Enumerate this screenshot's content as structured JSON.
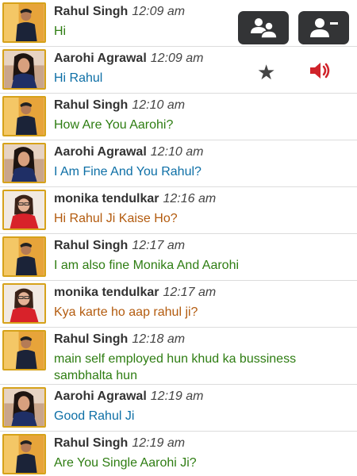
{
  "toolbar": {
    "group_icon": "group-users-icon",
    "remove_icon": "remove-user-icon",
    "star_icon": "star-icon",
    "volume_icon": "volume-icon",
    "volume_color": "#d0232a"
  },
  "colors": {
    "rahul_text": "#2e7d12",
    "aarohi_text": "#0d6fa6",
    "monika_text": "#b35b0e",
    "avatar_border": "#d6a21a"
  },
  "messages": [
    {
      "sender": "Rahul Singh",
      "time": "12:09 am",
      "text": "Hi",
      "kind": "rahul"
    },
    {
      "sender": "Aarohi Agrawal",
      "time": "12:09 am",
      "text": "Hi Rahul",
      "kind": "aarohi"
    },
    {
      "sender": "Rahul Singh",
      "time": "12:10 am",
      "text": "How Are You Aarohi?",
      "kind": "rahul"
    },
    {
      "sender": "Aarohi Agrawal",
      "time": "12:10 am",
      "text": "I Am Fine And You Rahul?",
      "kind": "aarohi"
    },
    {
      "sender": "monika tendulkar",
      "time": "12:16 am",
      "text": "Hi Rahul Ji Kaise Ho?",
      "kind": "monika"
    },
    {
      "sender": "Rahul Singh",
      "time": "12:17 am",
      "text": "I am also fine Monika And Aarohi",
      "kind": "rahul"
    },
    {
      "sender": "monika tendulkar",
      "time": "12:17 am",
      "text": "Kya karte ho aap rahul ji?",
      "kind": "monika"
    },
    {
      "sender": "Rahul Singh",
      "time": "12:18 am",
      "text": "main self employed hun khud ka bussiness sambhalta hun",
      "kind": "rahul"
    },
    {
      "sender": "Aarohi Agrawal",
      "time": "12:19 am",
      "text": "Good Rahul Ji",
      "kind": "aarohi"
    },
    {
      "sender": "Rahul Singh",
      "time": "12:19 am",
      "text": "Are You Single Aarohi Ji?",
      "kind": "rahul"
    }
  ]
}
